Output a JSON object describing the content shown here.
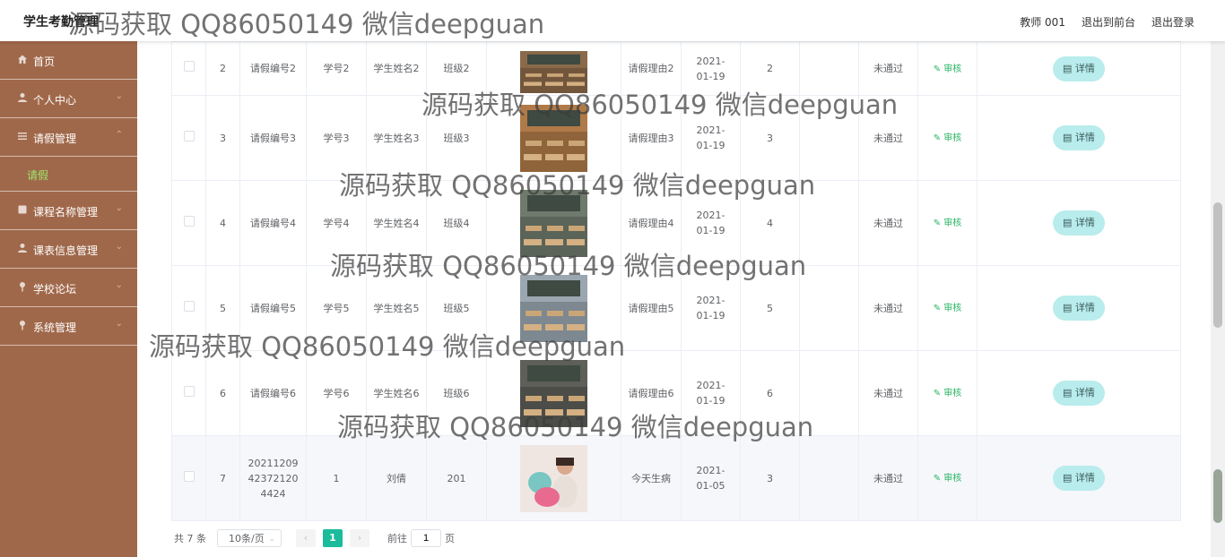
{
  "app": {
    "title": "学生考勤管理"
  },
  "header": {
    "user": "教师 001",
    "to_front": "退出到前台",
    "logout": "退出登录"
  },
  "sidebar": {
    "items": [
      {
        "label": "首页",
        "icon": "home-icon"
      },
      {
        "label": "个人中心",
        "icon": "user-icon"
      },
      {
        "label": "请假管理",
        "icon": "list-icon"
      },
      {
        "label": "课程名称管理",
        "icon": "book-icon"
      },
      {
        "label": "课表信息管理",
        "icon": "user-icon"
      },
      {
        "label": "学校论坛",
        "icon": "pin-icon"
      },
      {
        "label": "系统管理",
        "icon": "pin-icon"
      }
    ],
    "submenu": {
      "label": "请假"
    }
  },
  "table": {
    "audit_label": "审核",
    "detail_label": "详情",
    "rows": [
      {
        "index": "2",
        "leave_no": "请假编号2",
        "student_no": "学号2",
        "student_name": "学生姓名2",
        "class": "班级2",
        "reason": "请假理由2",
        "date": "2021-01-19",
        "days": "2",
        "blank": "",
        "status": "未通过",
        "image": "classroom-photo"
      },
      {
        "index": "3",
        "leave_no": "请假编号3",
        "student_no": "学号3",
        "student_name": "学生姓名3",
        "class": "班级3",
        "reason": "请假理由3",
        "date": "2021-01-19",
        "days": "3",
        "blank": "",
        "status": "未通过",
        "image": "classroom-photo"
      },
      {
        "index": "4",
        "leave_no": "请假编号4",
        "student_no": "学号4",
        "student_name": "学生姓名4",
        "class": "班级4",
        "reason": "请假理由4",
        "date": "2021-01-19",
        "days": "4",
        "blank": "",
        "status": "未通过",
        "image": "classroom-photo"
      },
      {
        "index": "5",
        "leave_no": "请假编号5",
        "student_no": "学号5",
        "student_name": "学生姓名5",
        "class": "班级5",
        "reason": "请假理由5",
        "date": "2021-01-19",
        "days": "5",
        "blank": "",
        "status": "未通过",
        "image": "classroom-photo"
      },
      {
        "index": "6",
        "leave_no": "请假编号6",
        "student_no": "学号6",
        "student_name": "学生姓名6",
        "class": "班级6",
        "reason": "请假理由6",
        "date": "2021-01-19",
        "days": "6",
        "blank": "",
        "status": "未通过",
        "image": "classroom-photo"
      },
      {
        "index": "7",
        "leave_no": "20211209423721204424",
        "student_no": "1",
        "student_name": "刘倩",
        "class": "201",
        "reason": "今天生病",
        "date": "2021-01-05",
        "days": "3",
        "blank": "",
        "status": "未通过",
        "image": "person-photo"
      }
    ]
  },
  "pagination": {
    "total": "共 7 条",
    "page_size": "10条/页",
    "current": "1",
    "goto_label": "前往",
    "goto_value": "1",
    "page_suffix": "页"
  },
  "watermark": "源码获取 QQ86050149 微信deepguan"
}
